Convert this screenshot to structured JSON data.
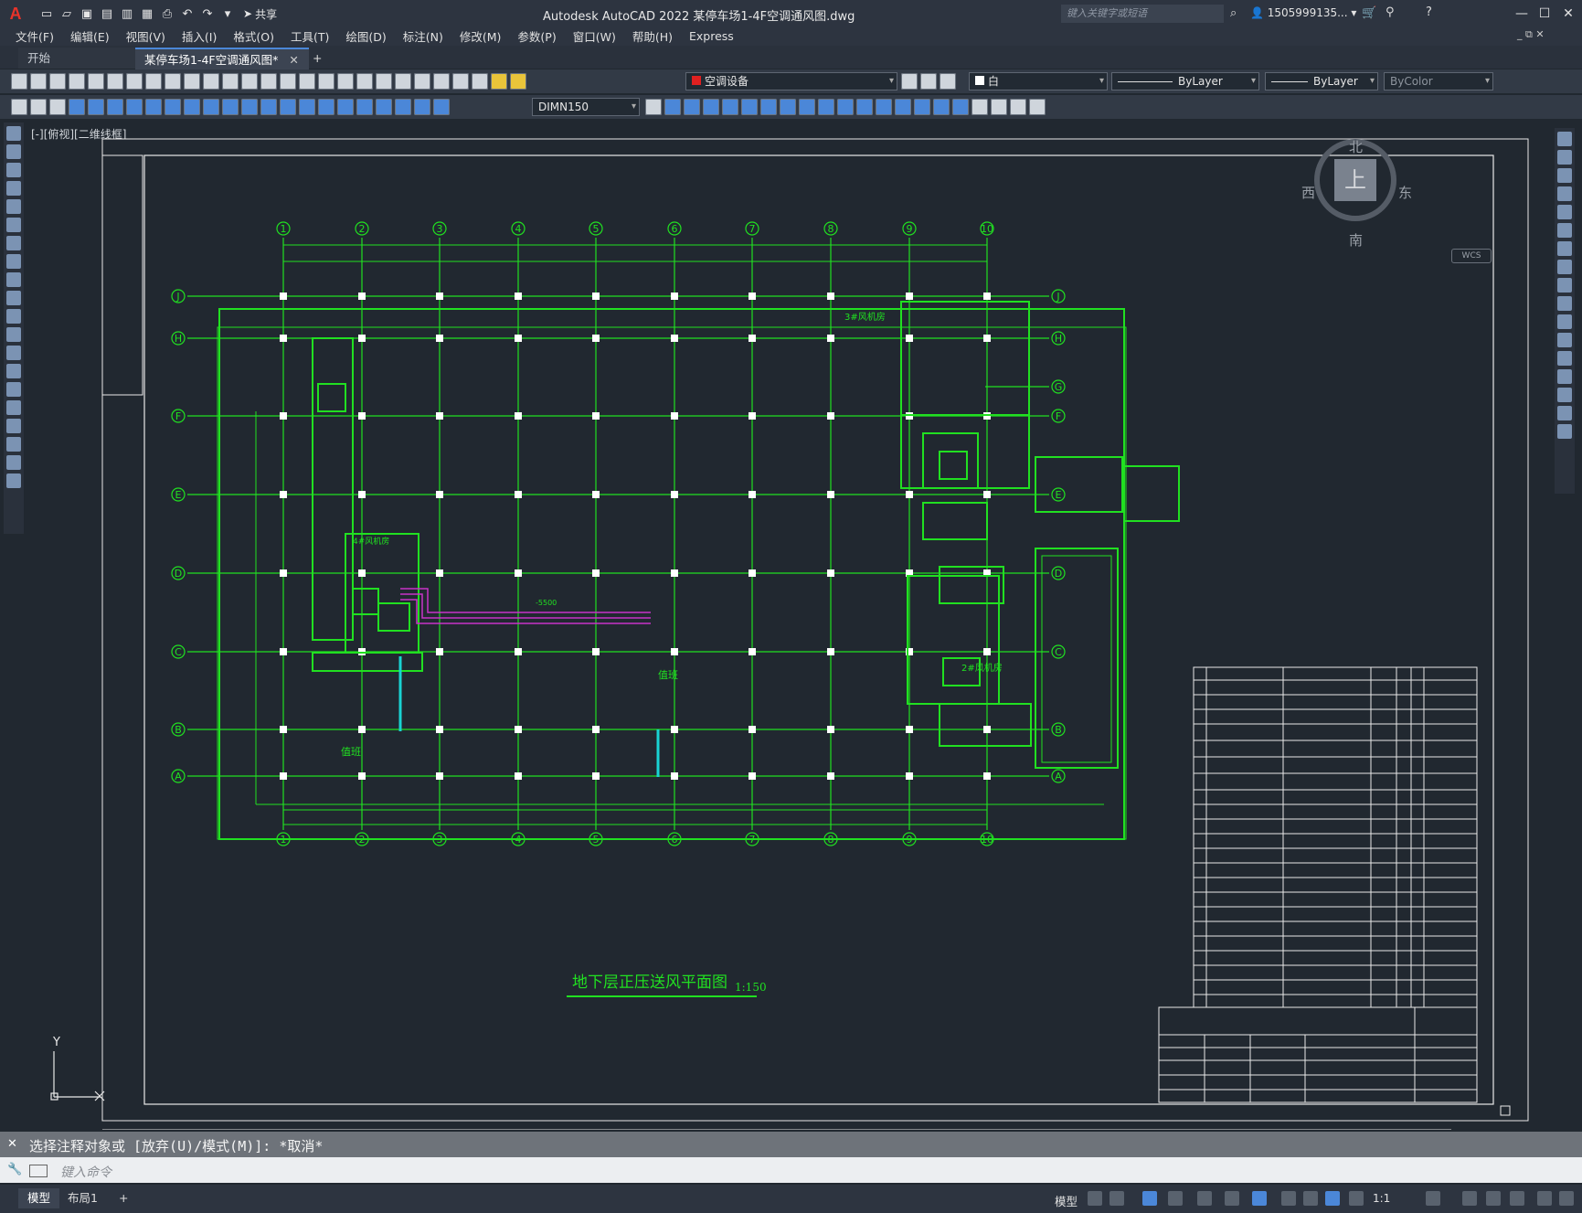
{
  "window": {
    "title": "Autodesk AutoCAD 2022    某停车场1-4F空调通风图.dwg",
    "search_placeholder": "键入关键字或短语",
    "user": "1505999135...",
    "share_label": "共享"
  },
  "menu": [
    "文件(F)",
    "编辑(E)",
    "视图(V)",
    "插入(I)",
    "格式(O)",
    "工具(T)",
    "绘图(D)",
    "标注(N)",
    "修改(M)",
    "参数(P)",
    "窗口(W)",
    "帮助(H)",
    "Express"
  ],
  "tabs": {
    "start": "开始",
    "active": "某停车场1-4F空调通风图*",
    "add": "+"
  },
  "toolbar": {
    "layer": "空调设备",
    "color": "白",
    "linetype": "ByLayer",
    "lineweight": "ByLayer",
    "plotstyle": "ByColor",
    "dimstyle": "DIMN150"
  },
  "viewport": {
    "label": "[-][俯视][二维线框]"
  },
  "viewcube": {
    "north": "北",
    "south": "南",
    "east": "东",
    "west": "西",
    "top": "上",
    "wcs": "WCS"
  },
  "drawing": {
    "title": "地下层正压送风平面图",
    "scale": "1:150",
    "column_axes": [
      "1",
      "2",
      "3",
      "4",
      "5",
      "6",
      "7",
      "8",
      "9",
      "10"
    ],
    "row_axes": [
      "J",
      "H",
      "G",
      "F",
      "E",
      "D",
      "C",
      "B",
      "A"
    ],
    "room_labels": {
      "fan_room_3": "3#风机房",
      "fan_room_4": "4#风机房",
      "fan_room_2": "2#风机房",
      "duty": "值班",
      "duty2": "值班",
      "duct_label": "-5500"
    }
  },
  "ucs": {
    "y": "Y"
  },
  "command": {
    "history": "选择注释对象或 [放弃(U)/模式(M)]: *取消*",
    "input_placeholder": "键入命令"
  },
  "status": {
    "model_tab": "模型",
    "layout_tab": "布局1",
    "add": "+",
    "model_label": "模型",
    "scale": "1:1"
  },
  "colors": {
    "drawing_green": "#21e021",
    "duct_magenta": "#c733c7",
    "duct_cyan": "#19d3d3",
    "white_line": "#e9e9e9"
  }
}
